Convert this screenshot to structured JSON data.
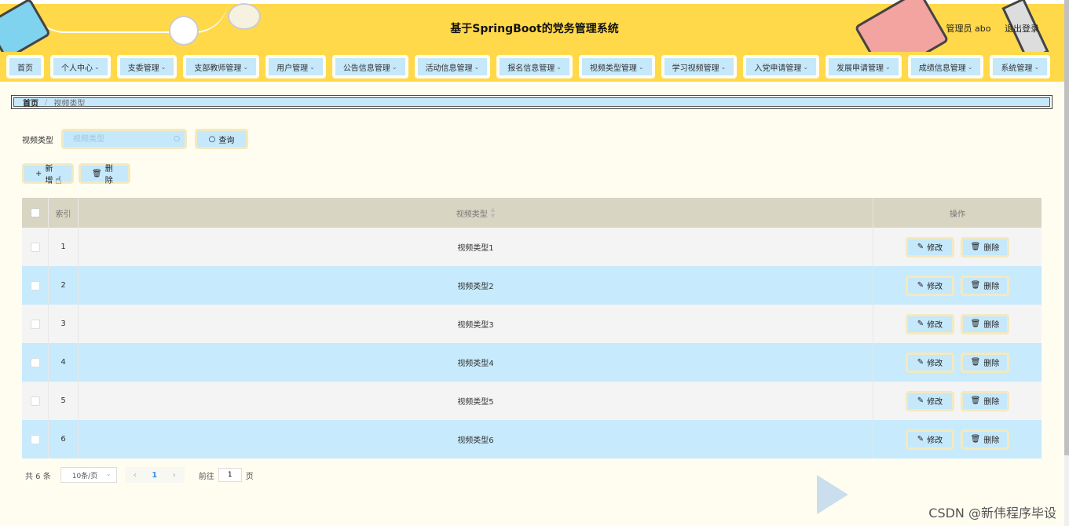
{
  "header": {
    "title": "基于SpringBoot的党务管理系统",
    "user_label": "管理员 abo",
    "logout_label": "退出登录"
  },
  "nav": {
    "items": [
      {
        "label": "首页",
        "has_dropdown": false
      },
      {
        "label": "个人中心",
        "has_dropdown": true
      },
      {
        "label": "支委管理",
        "has_dropdown": true
      },
      {
        "label": "支部教师管理",
        "has_dropdown": true
      },
      {
        "label": "用户管理",
        "has_dropdown": true
      },
      {
        "label": "公告信息管理",
        "has_dropdown": true
      },
      {
        "label": "活动信息管理",
        "has_dropdown": true
      },
      {
        "label": "报名信息管理",
        "has_dropdown": true
      },
      {
        "label": "视频类型管理",
        "has_dropdown": true
      },
      {
        "label": "学习视频管理",
        "has_dropdown": true
      },
      {
        "label": "入党申请管理",
        "has_dropdown": true
      },
      {
        "label": "发展申请管理",
        "has_dropdown": true
      },
      {
        "label": "成绩信息管理",
        "has_dropdown": true
      },
      {
        "label": "系统管理",
        "has_dropdown": true
      }
    ],
    "chevron": "⌄"
  },
  "breadcrumb": {
    "home": "首页",
    "separator": "/",
    "current": "视频类型"
  },
  "search": {
    "label": "视频类型",
    "placeholder": "视频类型",
    "value": "",
    "query_label": "查询",
    "search_icon": "search-icon"
  },
  "actions": {
    "add_label": "新增",
    "delete_label": "删除"
  },
  "table": {
    "headers": {
      "index": "索引",
      "type": "视频类型",
      "ops": "操作"
    },
    "rows": [
      {
        "index": "1",
        "type": "视频类型1"
      },
      {
        "index": "2",
        "type": "视频类型2"
      },
      {
        "index": "3",
        "type": "视频类型3"
      },
      {
        "index": "4",
        "type": "视频类型4"
      },
      {
        "index": "5",
        "type": "视频类型5"
      },
      {
        "index": "6",
        "type": "视频类型6"
      }
    ],
    "edit_label": "修改",
    "row_delete_label": "删除"
  },
  "pagination": {
    "total_text": "共 6 条",
    "page_size": "10条/页",
    "current_page": "1",
    "goto_prefix": "前往",
    "goto_value": "1",
    "goto_suffix": "页"
  },
  "watermark": "CSDN @新伟程序毕设",
  "colors": {
    "header_bg": "#ffd94a",
    "button_bg": "#c5e8fb",
    "row_alt_bg": "#c7eafc",
    "page_bg": "#fffdf0"
  }
}
